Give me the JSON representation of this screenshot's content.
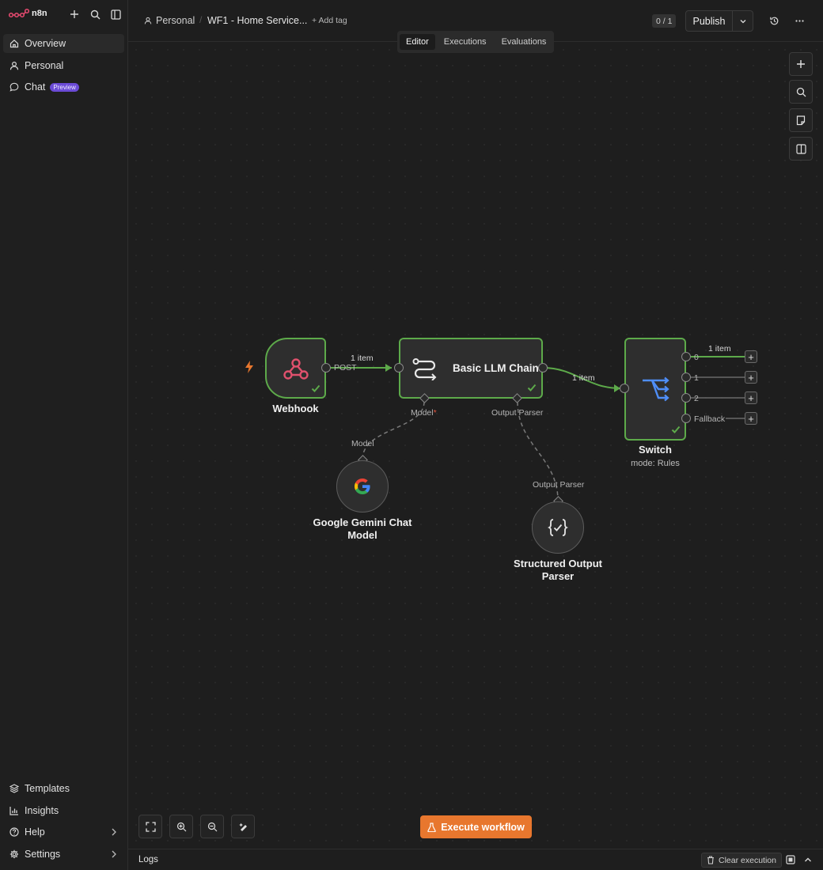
{
  "app": {
    "name": "n8n"
  },
  "sidebar": {
    "top_items": [
      {
        "label": "Overview",
        "icon": "home-icon"
      },
      {
        "label": "Personal",
        "icon": "user-icon"
      },
      {
        "label": "Chat",
        "icon": "chat-bubble-icon",
        "badge": "Preview"
      }
    ],
    "bottom_items": [
      {
        "label": "Templates",
        "icon": "templates-icon"
      },
      {
        "label": "Insights",
        "icon": "insights-chart-icon"
      },
      {
        "label": "Help",
        "icon": "help-circle-icon"
      },
      {
        "label": "Settings",
        "icon": "gear-icon"
      }
    ]
  },
  "header": {
    "project": "Personal",
    "workflow_name": "WF1 - Home Service...",
    "add_tag": "+ Add tag",
    "counter": "0 / 1",
    "publish_label": "Publish"
  },
  "tabs": [
    "Editor",
    "Executions",
    "Evaluations"
  ],
  "active_tab": "Editor",
  "nodes": {
    "webhook": {
      "label": "Webhook",
      "output_label": "POST"
    },
    "llm_chain": {
      "label": "Basic LLM Chain",
      "model_port": "Model",
      "model_required": "*",
      "parser_port": "Output Parser"
    },
    "switch": {
      "label": "Switch",
      "subtitle": "mode: Rules",
      "outputs": [
        "0",
        "1",
        "2",
        "Fallback"
      ]
    },
    "gemini": {
      "label_line1": "Google Gemini Chat",
      "label_line2": "Model",
      "port_label": "Model"
    },
    "parser": {
      "label_line1": "Structured Output",
      "label_line2": "Parser",
      "port_label": "Output Parser"
    }
  },
  "edges": {
    "webhook_to_llm": "1 item",
    "llm_to_switch": "1 item",
    "switch_out0": "1 item"
  },
  "canvas_actions": {
    "execute_label": "Execute workflow"
  },
  "logs": {
    "label": "Logs",
    "clear_label": "Clear execution"
  },
  "colors": {
    "accent_orange": "#e8772e",
    "success_green": "#5daa4a",
    "preview_purple": "#6b4bd6",
    "webhook_pink": "#e0516d",
    "switch_blue": "#4f8ef7"
  }
}
